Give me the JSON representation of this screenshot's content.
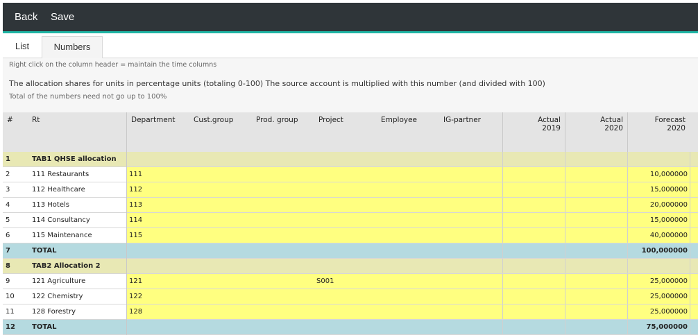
{
  "toolbar": {
    "back_label": "Back",
    "save_label": "Save"
  },
  "tabs": [
    {
      "label": "List",
      "active": false
    },
    {
      "label": "Numbers",
      "active": true
    }
  ],
  "info": {
    "hint": "Right click on the column header = maintain the time columns",
    "description": "The allocation shares for units in percentage units (totaling 0-100) The source account is multiplied with this number (and divided with 100)",
    "note": "Total of the numbers need not go up to 100%"
  },
  "grid": {
    "headers": {
      "num": "#",
      "rt": "Rt",
      "department": "Department",
      "cust_group": "Cust.group",
      "prod_group": "Prod. group",
      "project": "Project",
      "employee": "Employee",
      "ig_partner": "IG-partner",
      "actual2019_a": "Actual",
      "actual2019_b": "2019",
      "actual2020_a": "Actual",
      "actual2020_b": "2020",
      "forecast2020_a": "Forecast",
      "forecast2020_b": "2020"
    },
    "rows": [
      {
        "type": "group",
        "num": "1",
        "rt": "TAB1 QHSE allocation",
        "department": "",
        "project": "",
        "forecast": ""
      },
      {
        "type": "data",
        "num": "2",
        "rt": "111 Restaurants",
        "department": "111",
        "project": "",
        "forecast": "10,000000"
      },
      {
        "type": "data",
        "num": "3",
        "rt": "112 Healthcare",
        "department": "112",
        "project": "",
        "forecast": "15,000000"
      },
      {
        "type": "data",
        "num": "4",
        "rt": "113 Hotels",
        "department": "113",
        "project": "",
        "forecast": "20,000000"
      },
      {
        "type": "data",
        "num": "5",
        "rt": "114 Consultancy",
        "department": "114",
        "project": "",
        "forecast": "15,000000"
      },
      {
        "type": "data",
        "num": "6",
        "rt": "115 Maintenance",
        "department": "115",
        "project": "",
        "forecast": "40,000000"
      },
      {
        "type": "total",
        "num": "7",
        "rt": "TOTAL",
        "department": "",
        "project": "",
        "forecast": "100,000000"
      },
      {
        "type": "group",
        "num": "8",
        "rt": "TAB2 Allocation 2",
        "department": "",
        "project": "",
        "forecast": ""
      },
      {
        "type": "data",
        "num": "9",
        "rt": "121 Agriculture",
        "department": "121",
        "project": "S001",
        "forecast": "25,000000"
      },
      {
        "type": "data",
        "num": "10",
        "rt": "122 Chemistry",
        "department": "122",
        "project": "",
        "forecast": "25,000000"
      },
      {
        "type": "data",
        "num": "11",
        "rt": "128 Forestry",
        "department": "128",
        "project": "",
        "forecast": "25,000000"
      },
      {
        "type": "total",
        "num": "12",
        "rt": "TOTAL",
        "department": "",
        "project": "",
        "forecast": "75,000000"
      }
    ]
  }
}
